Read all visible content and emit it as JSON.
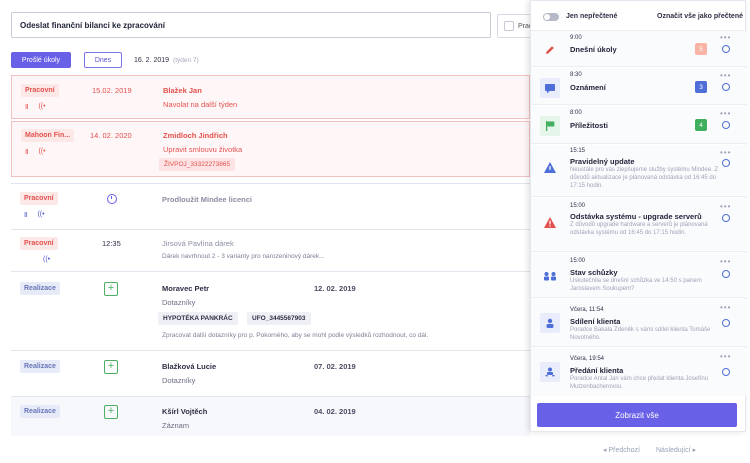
{
  "header": {
    "task_input_value": "Odeslat finanční bilanci ke zpracování",
    "category_select_label": "Prac"
  },
  "toolbar": {
    "overdue_label": "Prošlé úkoly",
    "today_label": "Dnes",
    "date": "16. 2. 2019",
    "week": "(týden 7)"
  },
  "tasks": [
    {
      "tag": "Pracovní",
      "date": "15.02. 2019",
      "title": "Blažek Jan",
      "subtitle": "Navolat na další týden"
    },
    {
      "tag": "Mahoon Fin...",
      "date": "14. 02. 2020",
      "title": "Zmidloch Jindřich",
      "subtitle": "Upravit smlouvu životka",
      "chip": "ŽIVPOJ_33322273865"
    },
    {
      "tag": "Pracovní",
      "title": "Prodloužit Mindee licenci"
    },
    {
      "tag": "Pracovní",
      "time": "12:35",
      "title": "Jirsová Pavlína dárek",
      "note": "Dárek navrhnout 2 - 3 varianty pro narozeninový dárek..."
    },
    {
      "tag": "Realizace",
      "title": "Moravec Petr",
      "date2": "12. 02. 2019",
      "subtitle": "Dotazníky",
      "chips": [
        "HYPOTÉKA PANKRÁC",
        "UFO_3445567903"
      ],
      "note": "Zpracovat další dotazníky pro p. Pokorného, aby se mohl podle výsledků rozhodnout, co dál."
    },
    {
      "tag": "Realizace",
      "title": "Blažková Lucie",
      "date2": "07. 02. 2019",
      "subtitle": "Dotazníky"
    },
    {
      "tag": "Realizace",
      "title": "Kšírl Vojtěch",
      "date2": "04. 02. 2019",
      "subtitle": "Záznam"
    }
  ],
  "pager": {
    "prev": "◂ Předchozí",
    "next": "Následující ▸"
  },
  "panel": {
    "unread_label": "Jen nepřečtené",
    "mark_all_label": "Označit vše jako přečtené",
    "more_glyph": "•••",
    "show_all_label": "Zobrazit vše",
    "notifications": [
      {
        "icon": "pencil-icon",
        "time": "9:00",
        "title": "Dnešní úkoly",
        "badge": "5",
        "badge_color": "#f59b8a"
      },
      {
        "icon": "chat-icon",
        "time": "8:30",
        "title": "Oznámení",
        "badge": "3",
        "badge_color": "#4e6fd8"
      },
      {
        "icon": "flag-icon",
        "time": "8:00",
        "title": "Příležitosti",
        "badge": "4",
        "badge_color": "#3fae5d"
      },
      {
        "icon": "info-triangle-icon",
        "time": "15:15",
        "title": "Pravidelný update",
        "desc": "Neustále pro vás zlepšujeme služby systému Mindee. Z důvodů aktualizace je plánovaná odstávka od 16:45 do 17:15 hodin."
      },
      {
        "icon": "warning-triangle-icon",
        "time": "15:00",
        "title": "Odstávka systému - upgrade serverů",
        "desc": "Z důvodů upgrade hardware a serverů je plánovaná odstávka systému od 16:45 do 17:15 hodin."
      },
      {
        "icon": "meeting-icon",
        "time": "15:00",
        "title": "Stav schůzky",
        "desc": "Uskutečnila se dnešní schůzka ve 14:50 s panem Jaroslavem Soukupem?"
      },
      {
        "icon": "share-client-icon",
        "time": "Včera, 11:54",
        "title": "Sdílení klienta",
        "desc": "Poradce Bakala Zdeněk s vámi sdílel klienta Tomáše Novotného."
      },
      {
        "icon": "handover-client-icon",
        "time": "Včera, 19:54",
        "title": "Předání klienta",
        "desc": "Poradce Antal Jan vám chce předat klienta Josefínu Mutzenbacherovou."
      }
    ]
  }
}
